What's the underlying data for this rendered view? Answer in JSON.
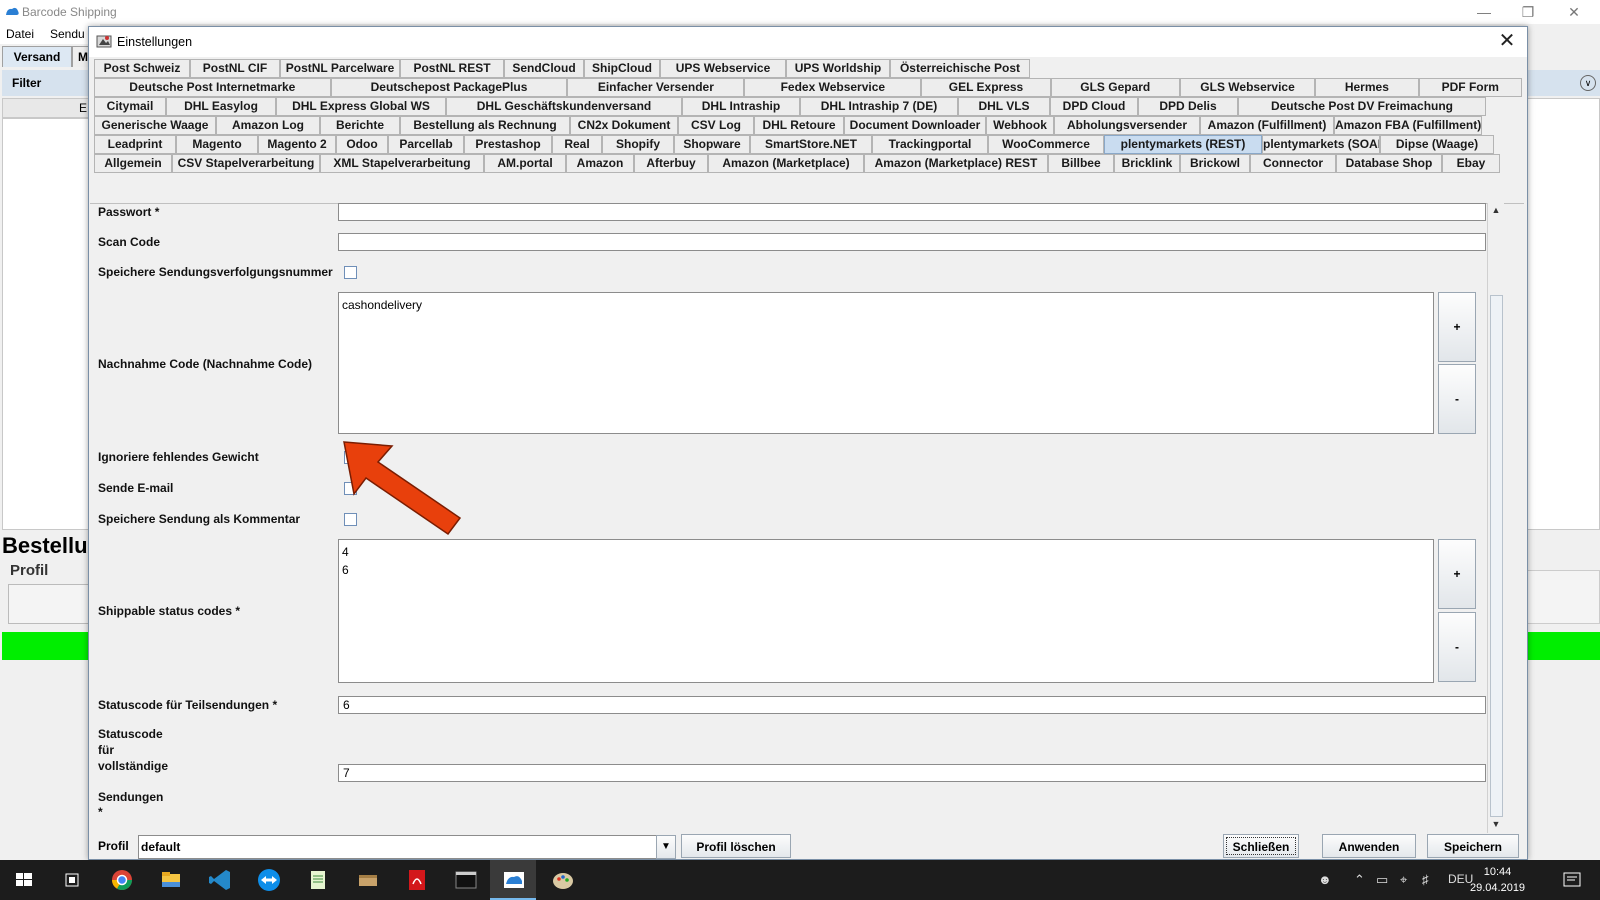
{
  "main_window": {
    "title": "Barcode Shipping",
    "menu": [
      "Datei",
      "Sendu"
    ],
    "tab_versand": "Versand",
    "tab_m": "M",
    "filter_label": "Filter",
    "grid_header_letter": "E",
    "bestellung_heading": "Bestellu",
    "profil_heading": "Profil",
    "status_color": "#00ee00",
    "window_controls": [
      "minimize-icon",
      "restore-icon",
      "close-icon"
    ]
  },
  "dialog": {
    "title": "Einstellungen",
    "tab_rows": [
      [
        "Post Schweiz",
        "PostNL CIF",
        "PostNL Parcelware",
        "PostNL REST",
        "SendCloud",
        "ShipCloud",
        "UPS Webservice",
        "UPS Worldship",
        "Österreichische Post"
      ],
      [
        "Deutsche Post Internetmarke",
        "Deutschepost PackagePlus",
        "Einfacher Versender",
        "Fedex Webservice",
        "GEL Express",
        "GLS Gepard",
        "GLS Webservice",
        "Hermes",
        "PDF Form"
      ],
      [
        "Citymail",
        "DHL Easylog",
        "DHL Express Global WS",
        "DHL Geschäftskundenversand",
        "DHL Intraship",
        "DHL Intraship 7 (DE)",
        "DHL VLS",
        "DPD Cloud",
        "DPD Delis",
        "Deutsche Post DV Freimachung"
      ],
      [
        "Generische Waage",
        "Amazon Log",
        "Berichte",
        "Bestellung als Rechnung",
        "CN2x Dokument",
        "CSV Log",
        "DHL Retoure",
        "Document Downloader",
        "Webhook",
        "Abholungsversender",
        "Amazon (Fulfillment)",
        "Amazon FBA (Fulfillment)"
      ],
      [
        "Leadprint",
        "Magento",
        "Magento 2",
        "Odoo",
        "Parcellab",
        "Prestashop",
        "Real",
        "Shopify",
        "Shopware",
        "SmartStore.NET",
        "Trackingportal",
        "WooCommerce",
        "plentymarkets (REST)",
        "plentymarkets (SOAP)",
        "Dipse (Waage)"
      ],
      [
        "Allgemein",
        "CSV Stapelverarbeitung",
        "XML Stapelverarbeitung",
        "AM.portal",
        "Amazon",
        "Afterbuy",
        "Amazon (Marketplace)",
        "Amazon (Marketplace) REST",
        "Billbee",
        "Bricklink",
        "Brickowl",
        "Connector",
        "Database Shop",
        "Ebay"
      ]
    ],
    "selected_tab": "plentymarkets (REST)",
    "fields": {
      "passwort_label": "Passwort *",
      "passwort_value": "",
      "scancode_label": "Scan Code",
      "scancode_value": "",
      "speichere_tracking_label": "Speichere Sendungsverfolgungsnummer",
      "nachnahme_label": "Nachnahme Code (Nachnahme Code)",
      "nachnahme_values": [
        "cashondelivery"
      ],
      "ignoriere_gewicht_label": "Ignoriere fehlendes Gewicht",
      "sende_email_label": "Sende E-mail",
      "speichere_kommentar_label": "Speichere Sendung als Kommentar",
      "shippable_label": "Shippable status codes *",
      "shippable_values": [
        "4",
        "6"
      ],
      "teilsendungen_label": "Statuscode für Teilsendungen *",
      "teilsendungen_value": "6",
      "vollstaendige_label_lines": [
        "Statuscode",
        "für",
        "vollständige"
      ],
      "vollstaendige_value": "7",
      "sendungen_label_lines": [
        "Sendungen",
        "*"
      ],
      "plus": "+",
      "minus": "-"
    },
    "bottom": {
      "profil_label": "Profil",
      "profil_value": "default",
      "profil_loeschen": "Profil löschen",
      "schliessen": "Schließen",
      "anwenden": "Anwenden",
      "speichern": "Speichern"
    },
    "annotation_arrow_color": "#e8400c"
  },
  "taskbar": {
    "language": "DEU",
    "time": "10:44",
    "date": "29.04.2019",
    "icons": [
      "windows-start-icon",
      "task-view-icon",
      "chrome-icon",
      "file-explorer-icon",
      "vscode-icon",
      "teamviewer-icon",
      "notepad-icon",
      "package-icon",
      "pdf-icon",
      "terminal-icon",
      "barcode-shipping-icon",
      "paint-icon"
    ]
  }
}
